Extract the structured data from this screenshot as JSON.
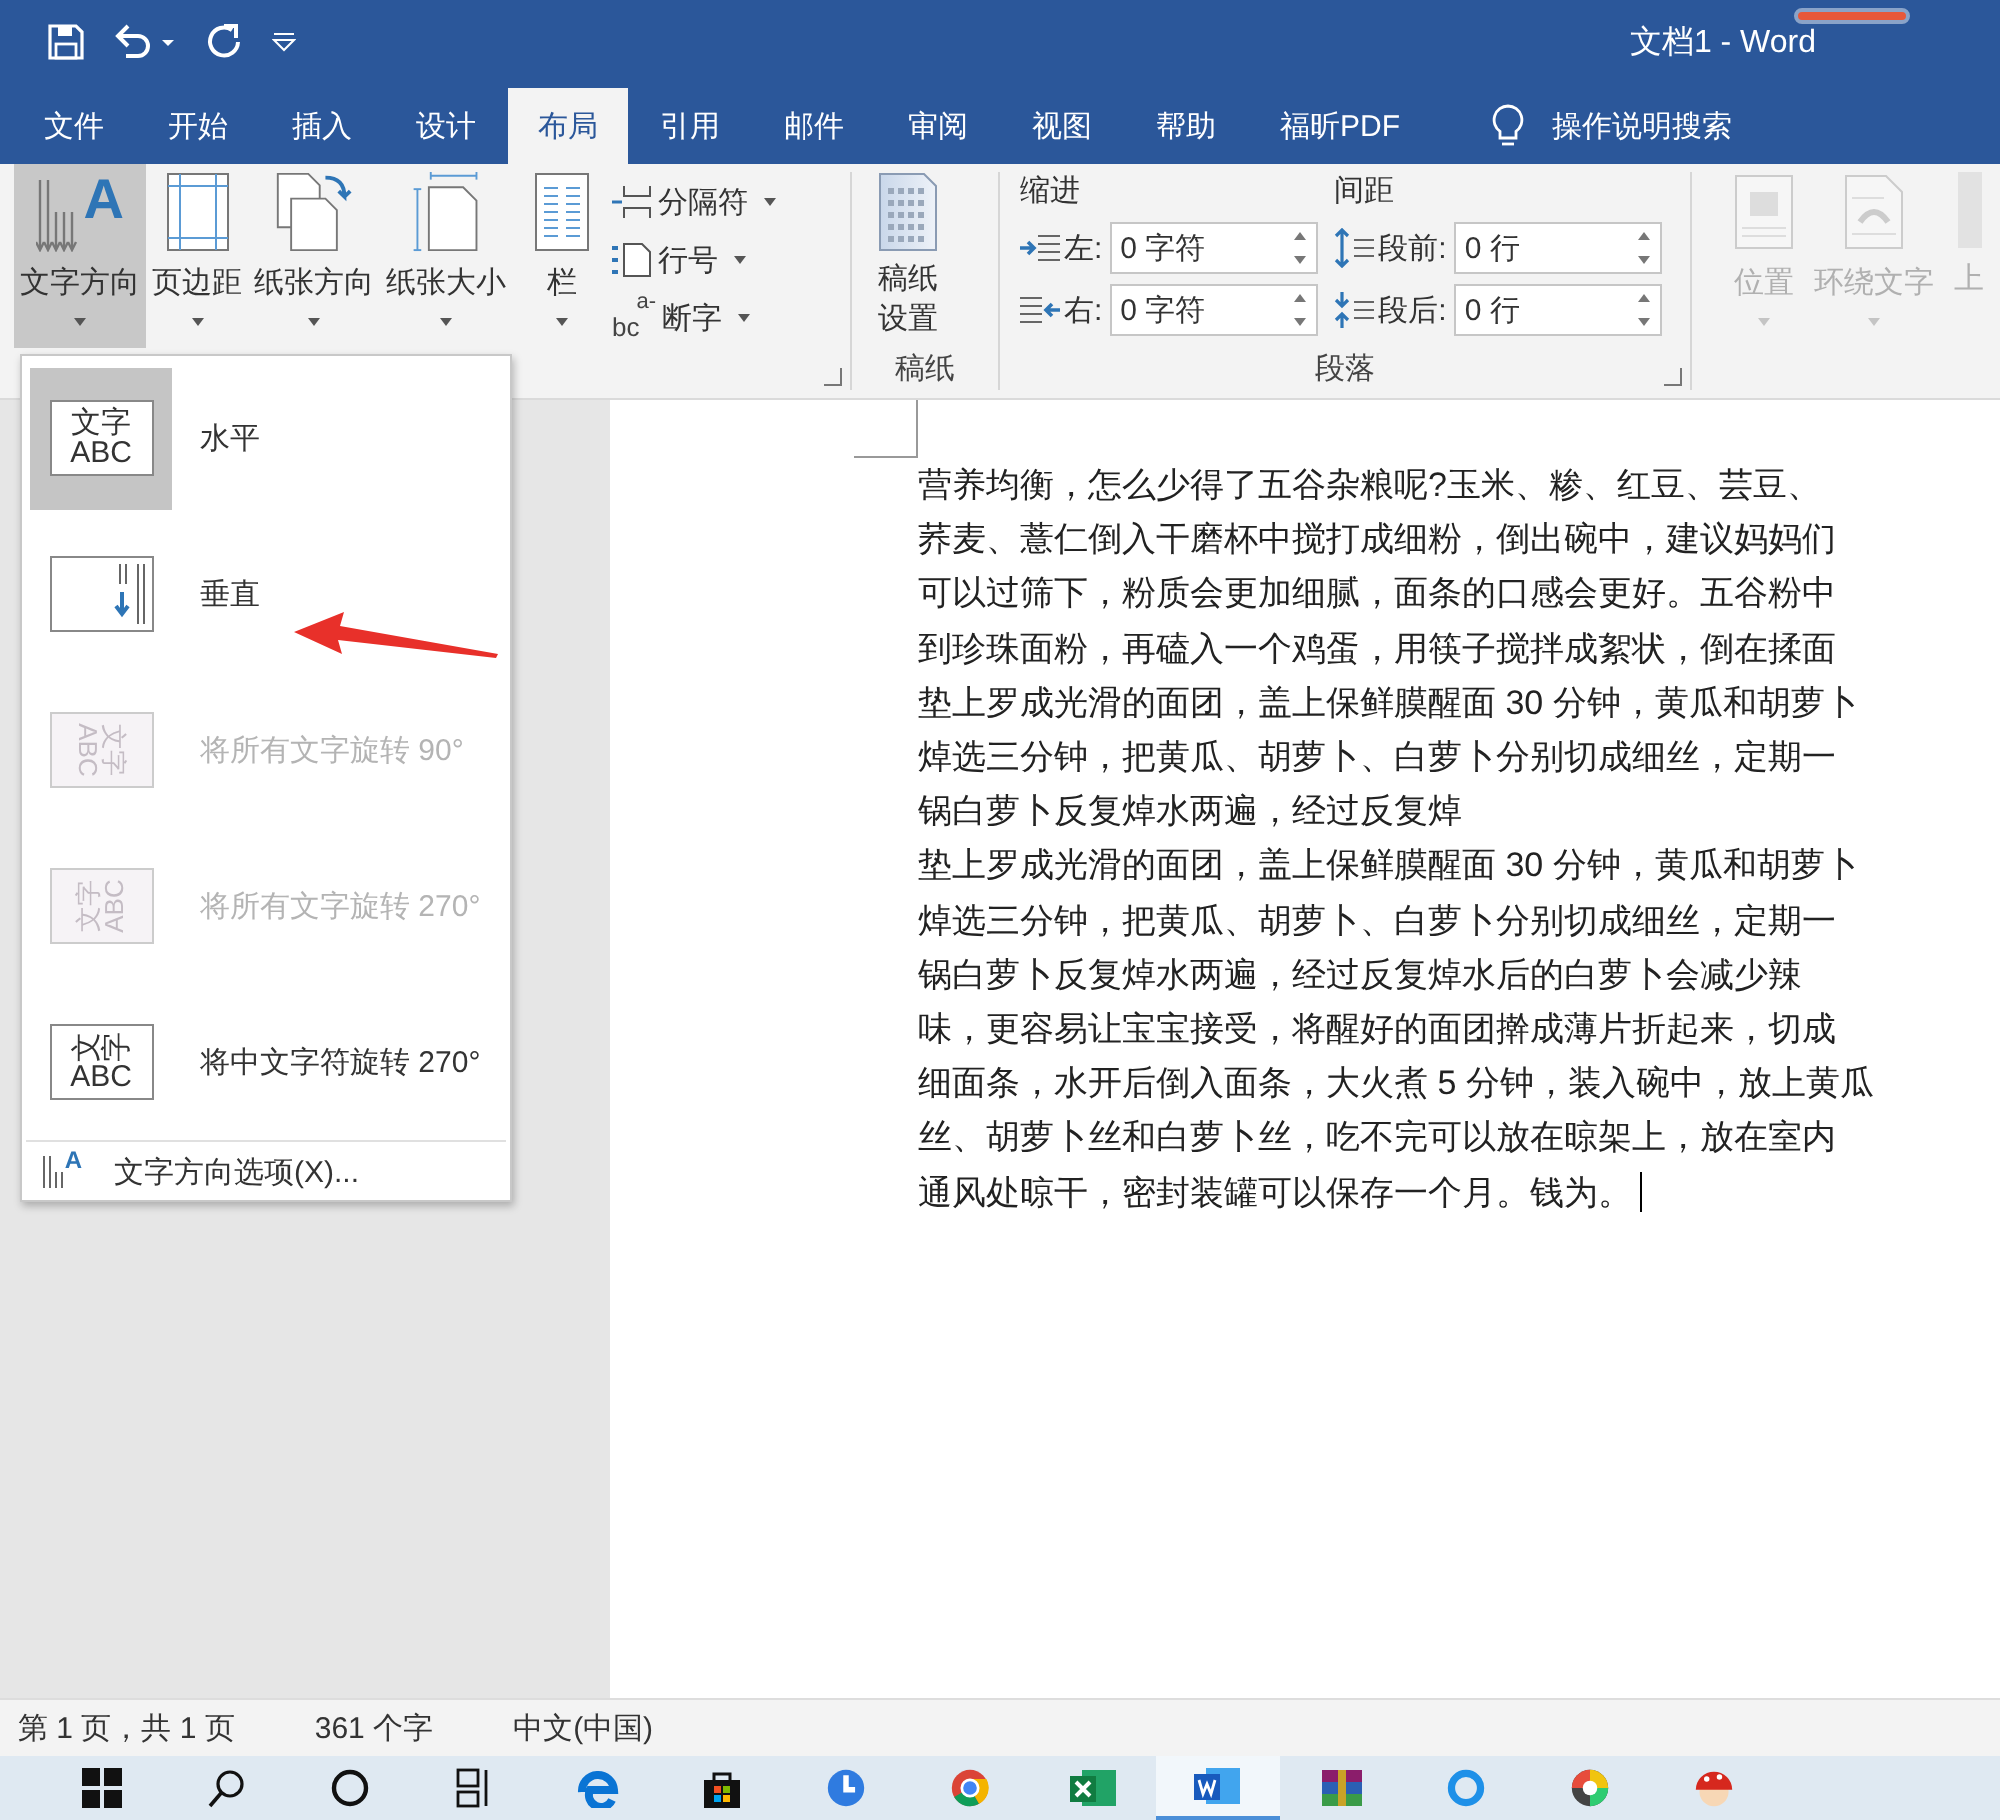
{
  "window": {
    "title": "文档1 - Word"
  },
  "tabs": [
    {
      "label": "文件",
      "selected": false
    },
    {
      "label": "开始",
      "selected": false
    },
    {
      "label": "插入",
      "selected": false
    },
    {
      "label": "设计",
      "selected": false
    },
    {
      "label": "布局",
      "selected": true
    },
    {
      "label": "引用",
      "selected": false
    },
    {
      "label": "邮件",
      "selected": false
    },
    {
      "label": "审阅",
      "selected": false
    },
    {
      "label": "视图",
      "selected": false
    },
    {
      "label": "帮助",
      "selected": false
    },
    {
      "label": "福昕PDF",
      "selected": false
    }
  ],
  "tell_me": {
    "label": "操作说明搜索"
  },
  "ribbon": {
    "page_setup": {
      "buttons": [
        {
          "kind": "text-direction",
          "label": "文字方向",
          "icon_text": "A",
          "expanded": true
        },
        {
          "kind": "margins",
          "label": "页边距",
          "expanded": false
        },
        {
          "kind": "orientation",
          "label": "纸张方向",
          "expanded": false
        },
        {
          "kind": "size",
          "label": "纸张大小",
          "expanded": false
        },
        {
          "kind": "columns",
          "label": "栏",
          "expanded": false
        }
      ],
      "small_buttons": [
        {
          "kind": "breaks",
          "label": "分隔符"
        },
        {
          "kind": "line-numbers",
          "label": "行号"
        },
        {
          "kind": "hyphenation",
          "label": "断字",
          "icon_text": [
            "a-",
            "bc"
          ]
        }
      ]
    },
    "manuscript": {
      "label": "稿纸",
      "button": "稿纸设置"
    },
    "paragraph": {
      "label": "段落",
      "indent": {
        "heading": "缩进",
        "fields": [
          {
            "kind": "indent-left",
            "label": "左:",
            "value": "0 字符"
          },
          {
            "kind": "indent-right",
            "label": "右:",
            "value": "0 字符"
          }
        ]
      },
      "spacing": {
        "heading": "间距",
        "fields": [
          {
            "kind": "space-before",
            "label": "段前:",
            "value": "0 行"
          },
          {
            "kind": "space-after",
            "label": "段后:",
            "value": "0 行"
          }
        ]
      }
    },
    "arrange": {
      "buttons": [
        {
          "kind": "position",
          "label": "位置",
          "disabled": true
        },
        {
          "kind": "wrap",
          "label": "环绕文字",
          "disabled": true
        },
        {
          "kind": "forward",
          "label": "上",
          "disabled": true
        }
      ]
    }
  },
  "text_direction_menu": {
    "items": [
      {
        "kind": "horizontal",
        "label": "水平",
        "icon_text": [
          "文字",
          "ABC"
        ],
        "selected": true,
        "disabled": false
      },
      {
        "kind": "vertical",
        "label": "垂直",
        "selected": false,
        "disabled": false
      },
      {
        "kind": "rotate90",
        "label": "将所有文字旋转 90°",
        "icon_text": [
          "文字",
          "ABC"
        ],
        "selected": false,
        "disabled": true
      },
      {
        "kind": "rotate270",
        "label": "将所有文字旋转 270°",
        "icon_text": [
          "文字",
          "ABC"
        ],
        "selected": false,
        "disabled": true
      },
      {
        "kind": "stacked270",
        "label": "将中文字符旋转 270°",
        "icon_text": [
          "文字",
          "ABC"
        ],
        "selected": false,
        "disabled": false
      }
    ],
    "options": {
      "label": "文字方向选项(X)...",
      "icon_text": "A"
    }
  },
  "document": {
    "paragraphs": [
      {
        "lines": [
          "营养均衡，怎么少得了五谷杂粮呢?玉米、糁、红豆、芸豆、",
          "荞麦、薏仁倒入干磨杯中搅打成细粉，倒出碗中，建议妈妈们",
          "可以过筛下，粉质会更加细腻，面条的口感会更好。五谷粉中",
          "到珍珠面粉，再磕入一个鸡蛋，用筷子搅拌成絮状，倒在揉面",
          "垫上罗成光滑的面团，盖上保鲜膜醒面 30 分钟，黄瓜和胡萝卜",
          "焯选三分钟，把黄瓜、胡萝卜、白萝卜分别切成细丝，定期一",
          "锅白萝卜反复焯水两遍，经过反复焯"
        ]
      },
      {
        "lines": [
          "垫上罗成光滑的面团，盖上保鲜膜醒面 30 分钟，黄瓜和胡萝卜",
          "焯选三分钟，把黄瓜、胡萝卜、白萝卜分别切成细丝，定期一",
          "锅白萝卜反复焯水两遍，经过反复焯水后的白萝卜会减少辣",
          "味，更容易让宝宝接受，将醒好的面团擀成薄片折起来，切成",
          "细面条，水开后倒入面条，大火煮 5 分钟，装入碗中，放上黄瓜",
          "丝、胡萝卜丝和白萝卜丝，吃不完可以放在晾架上，放在室内",
          "通风处晾干，密封装罐可以保存一个月。钱为。"
        ]
      }
    ]
  },
  "status_bar": [
    "第 1 页，共 1 页",
    "361 个字",
    "中文(中国)"
  ],
  "taskbar": {
    "apps": [
      {
        "kind": "start",
        "active": false
      },
      {
        "kind": "search",
        "active": false
      },
      {
        "kind": "cortana",
        "active": false
      },
      {
        "kind": "task-view",
        "active": false
      },
      {
        "kind": "edge",
        "active": false
      },
      {
        "kind": "store",
        "active": false
      },
      {
        "kind": "clock",
        "active": false
      },
      {
        "kind": "chrome",
        "active": false
      },
      {
        "kind": "excel",
        "active": false
      },
      {
        "kind": "word",
        "active": true
      },
      {
        "kind": "archive",
        "active": false
      },
      {
        "kind": "ring",
        "active": false
      },
      {
        "kind": "gauge",
        "active": false
      },
      {
        "kind": "mascot",
        "active": false
      }
    ]
  }
}
